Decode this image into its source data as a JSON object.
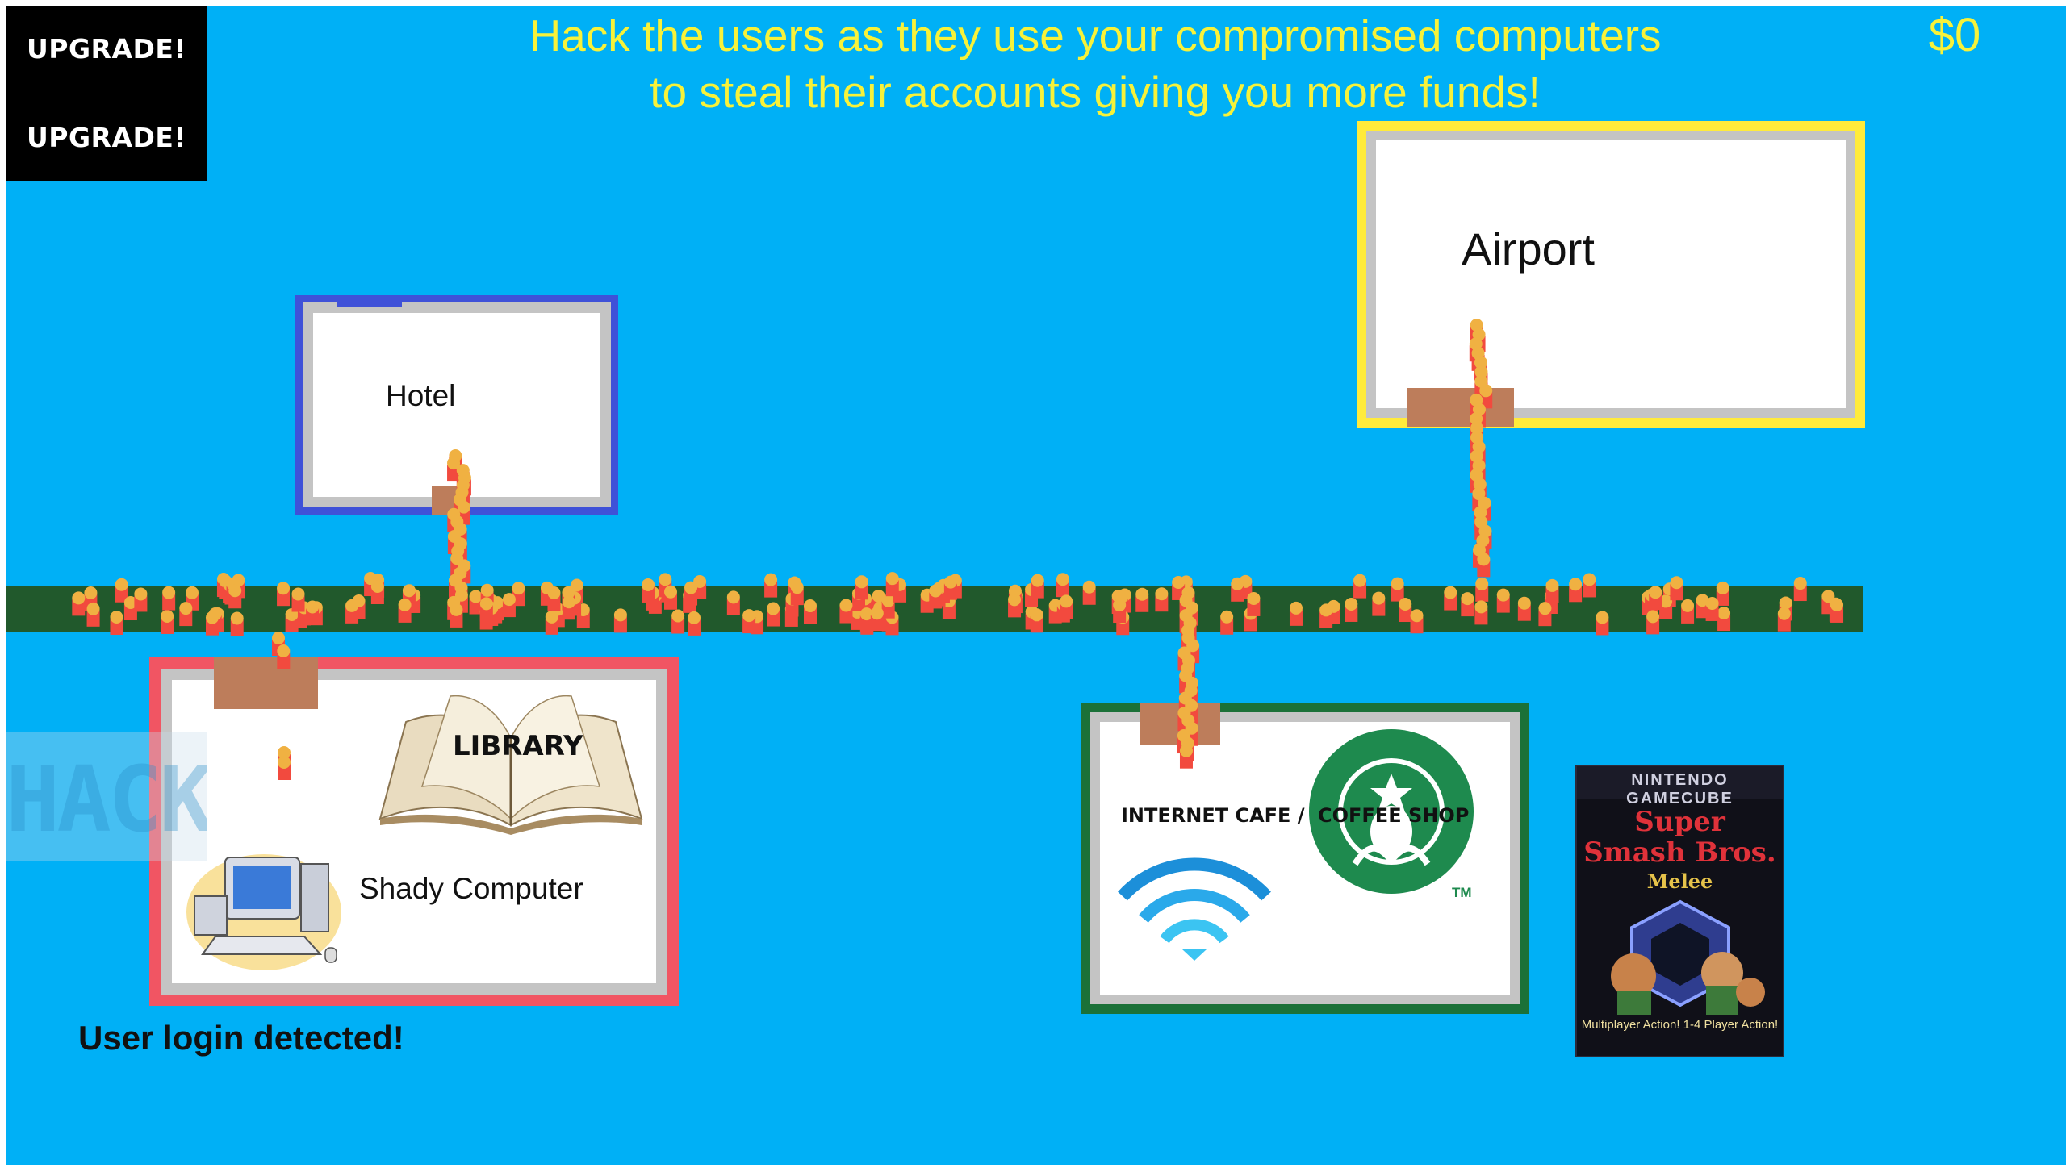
{
  "upgrades": {
    "buttons": [
      "UPGRADE!",
      "UPGRADE!"
    ]
  },
  "header": {
    "line1": "Hack the users as they use your compromised computers",
    "line2": "to steal their accounts giving you more funds!",
    "money": "$0"
  },
  "locations": {
    "hotel": {
      "label": "Hotel"
    },
    "airport": {
      "label": "Airport"
    },
    "library": {
      "label": "LIBRARY",
      "computer_label": "Shady Computer"
    },
    "cafe": {
      "label_left": "INTERNET CAFE /",
      "label_right": "COFFEE SHOP",
      "tm": "TM"
    }
  },
  "hack_button": {
    "label": "HACK"
  },
  "status": {
    "message": "User login detected!"
  },
  "game_cover": {
    "brand": "NINTENDO GAMECUBE",
    "title_line1": "Super",
    "title_line2": "Smash Bros.",
    "subtitle": "Melee",
    "footer": "Multiplayer Action! 1-4 Player Action!"
  },
  "colors": {
    "sky": "#00b0f6",
    "road": "#21592c",
    "text_yellow": "#f7f23a",
    "hotel_border": "#3f51d8",
    "airport_border": "#ffeb3b",
    "library_border": "#f15563",
    "cafe_border": "#1b7138",
    "door": "#bd7d5b",
    "person_body": "#f24a3e",
    "person_head": "#f0b142"
  }
}
